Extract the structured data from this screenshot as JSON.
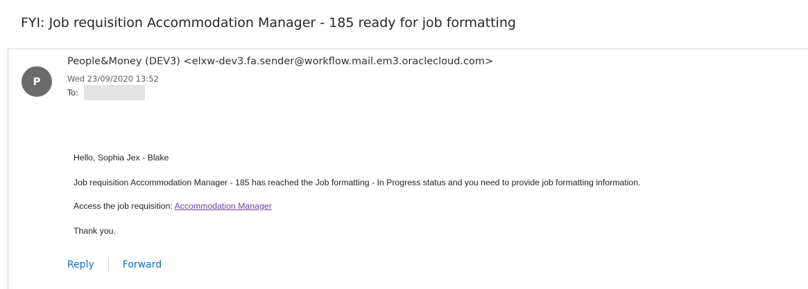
{
  "message": {
    "subject": "FYI: Job requisition Accommodation Manager - 185 ready for job formatting",
    "sender": {
      "initial": "P",
      "display": "People&Money (DEV3) <elxw-dev3.fa.sender@workflow.mail.em3.oraclecloud.com>"
    },
    "date": "Wed 23/09/2020 13:52",
    "to_label": "To:",
    "body": {
      "greeting": "Hello, Sophia Jex - Blake",
      "line2": "Job requisition Accommodation Manager - 185 has reached the Job formatting - In Progress status and you need to provide job formatting information.",
      "line3_prefix": "Access the job requisition: ",
      "line3_link": "Accommodation Manager",
      "closing": "Thank you."
    },
    "actions": {
      "reply": "Reply",
      "forward": "Forward"
    }
  },
  "colors": {
    "avatar_bg": "#6b6b6b",
    "action_blue": "#0f6cbd",
    "link_purple": "#6b3fa0"
  }
}
